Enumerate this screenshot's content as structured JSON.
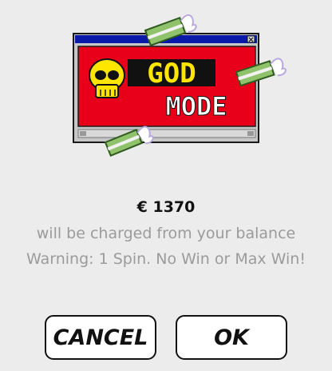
{
  "artwork": {
    "name": "god-mode-banner",
    "line1": "GOD",
    "line2": "MODE",
    "colors": {
      "banner_red": "#e8001a",
      "text_yellow": "#ffe600",
      "text_white": "#ffffff",
      "frame_gray": "#bdbdbd",
      "titlebar_blue": "#0a1aa8"
    }
  },
  "dialog": {
    "price": "€ 1370",
    "charge_text": "will be charged from your balance",
    "warning_text": "Warning: 1 Spin. No Win or Max Win!"
  },
  "buttons": {
    "cancel_label": "CANCEL",
    "ok_label": "OK"
  },
  "colors": {
    "background": "#ececec",
    "text_dark": "#111111",
    "text_muted": "#9b9b9b"
  }
}
